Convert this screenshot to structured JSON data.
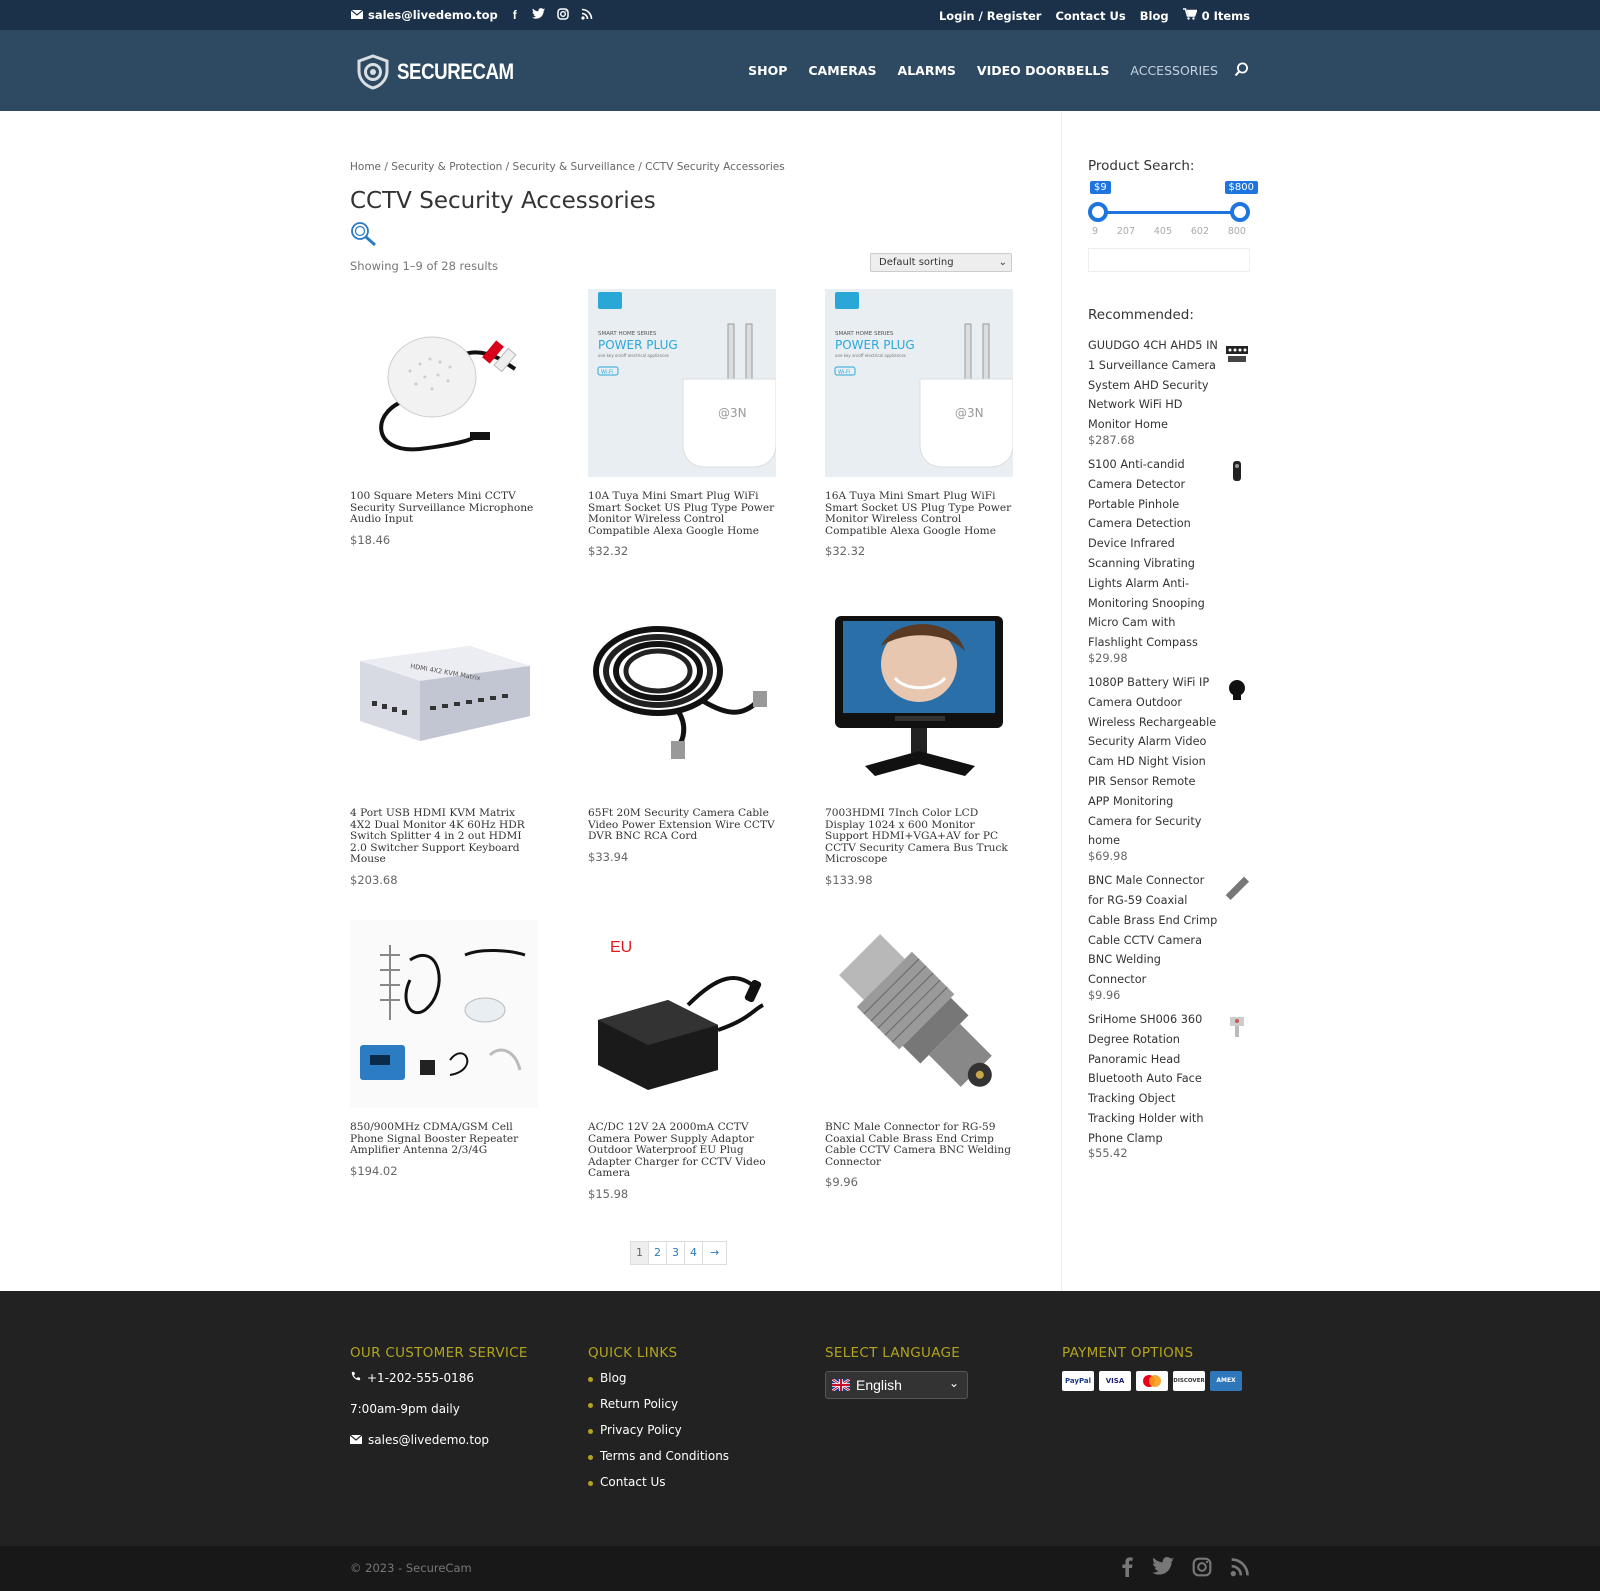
{
  "topbar": {
    "email": "sales@livedemo.top",
    "links": [
      "Login / Register",
      "Contact Us",
      "Blog"
    ],
    "cart_label": "0 Items"
  },
  "header": {
    "logo_text": "SECURECAM",
    "nav": [
      "SHOP",
      "CAMERAS",
      "ALARMS",
      "VIDEO DOORBELLS",
      "ACCESSORIES"
    ],
    "active_nav": "ACCESSORIES"
  },
  "main": {
    "breadcrumb": "Home / Security & Protection / Security & Surveillance / CCTV Security Accessories",
    "title": "CCTV Security Accessories",
    "result_count": "Showing 1–9 of 28 results",
    "sort_value": "Default sorting",
    "products": [
      {
        "name": "100 Square Meters Mini CCTV Security Surveillance Microphone Audio Input",
        "price": "$18.46",
        "image": "microphone"
      },
      {
        "name": "10A Tuya Mini Smart Plug WiFi Smart Socket US Plug Type Power Monitor Wireless Control Compatible Alexa Google Home",
        "price": "$32.32",
        "image": "power-plug"
      },
      {
        "name": "16A Tuya Mini Smart Plug WiFi Smart Socket US Plug Type Power Monitor Wireless Control Compatible Alexa Google Home",
        "price": "$32.32",
        "image": "power-plug"
      },
      {
        "name": "4 Port USB HDMI KVM Matrix 4X2 Dual Monitor 4K 60Hz HDR Switch Splitter 4 in 2 out HDMI 2.0 Switcher Support Keyboard Mouse",
        "price": "$203.68",
        "image": "kvm-switch"
      },
      {
        "name": "65Ft 20M Security Camera Cable Video Power Extension Wire CCTV DVR BNC RCA Cord",
        "price": "$33.94",
        "image": "cable"
      },
      {
        "name": "7003HDMI 7Inch Color LCD Display 1024 x 600 Monitor Support HDMI+VGA+AV for PC CCTV Security Camera Bus Truck Microscope",
        "price": "$133.98",
        "image": "lcd-monitor"
      },
      {
        "name": "850/900MHz CDMA/GSM Cell Phone Signal Booster Repeater Amplifier Antenna 2/3/4G",
        "price": "$194.02",
        "image": "signal-booster"
      },
      {
        "name": "AC/DC 12V 2A 2000mA CCTV Camera Power Supply Adaptor Outdoor Waterproof EU Plug Adapter Charger for CCTV Video Camera",
        "price": "$15.98",
        "image": "power-adaptor"
      },
      {
        "name": "BNC Male Connector for RG-59 Coaxial Cable Brass End Crimp Cable CCTV Camera BNC Welding Connector",
        "price": "$9.96",
        "image": "bnc-connector"
      }
    ],
    "plug_text": {
      "series": "SMART HOME SERIES",
      "title": "POWER PLUG",
      "sub": "one key on/off electrical appliances",
      "wifi": "Wi-Fi"
    },
    "adaptor_label": "EU",
    "pagination": [
      "1",
      "2",
      "3",
      "4",
      "→"
    ]
  },
  "sidebar": {
    "search_title": "Product Search:",
    "price_min_label": "$9",
    "price_max_label": "$800",
    "price_min": 9,
    "price_max": 800,
    "ticks": [
      "9",
      "207",
      "405",
      "602",
      "800"
    ],
    "recommended_title": "Recommended:",
    "recommended": [
      {
        "name": "GUUDGO 4CH AHD5 IN 1 Surveillance Camera System AHD Security Network WiFi HD Monitor Home",
        "price": "$287.68"
      },
      {
        "name": "S100 Anti-candid Camera Detector Portable Pinhole Camera Detection Device Infrared Scanning Vibrating Lights Alarm Anti-Monitoring Snooping Micro Cam with Flashlight Compass",
        "price": "$29.98"
      },
      {
        "name": "1080P Battery WiFi IP Camera Outdoor Wireless Rechargeable Security Alarm Video Cam HD Night Vision PIR Sensor Remote APP Monitoring Camera for Security home",
        "price": "$69.98"
      },
      {
        "name": "BNC Male Connector for RG-59 Coaxial Cable Brass End Crimp Cable CCTV Camera BNC Welding Connector",
        "price": "$9.96"
      },
      {
        "name": "SriHome SH006 360 Degree Rotation Panoramic Head Bluetooth Auto Face Tracking Object Tracking Holder with Phone Clamp",
        "price": "$55.42"
      }
    ]
  },
  "footer": {
    "cs_title": "OUR CUSTOMER SERVICE",
    "phone": "+1-202-555-0186",
    "hours": "7:00am-9pm daily",
    "email": "sales@livedemo.top",
    "ql_title": "QUICK LINKS",
    "quick_links": [
      "Blog",
      "Return Policy",
      "Privacy Policy",
      "Terms and Conditions",
      "Contact Us"
    ],
    "lang_title": "SELECT LANGUAGE",
    "lang_value": "English",
    "pay_title": "PAYMENT OPTIONS",
    "payments": [
      "PayPal",
      "VISA",
      "MC",
      "DISCOVER",
      "AMEX"
    ],
    "copyright": "© 2023 - SecureCam"
  },
  "colors": {
    "topbar": "#1b3149",
    "header": "#2e4a63",
    "accent_blue": "#1e75e0",
    "footer_heading": "#b3a41e",
    "footer_bg": "#222222"
  }
}
